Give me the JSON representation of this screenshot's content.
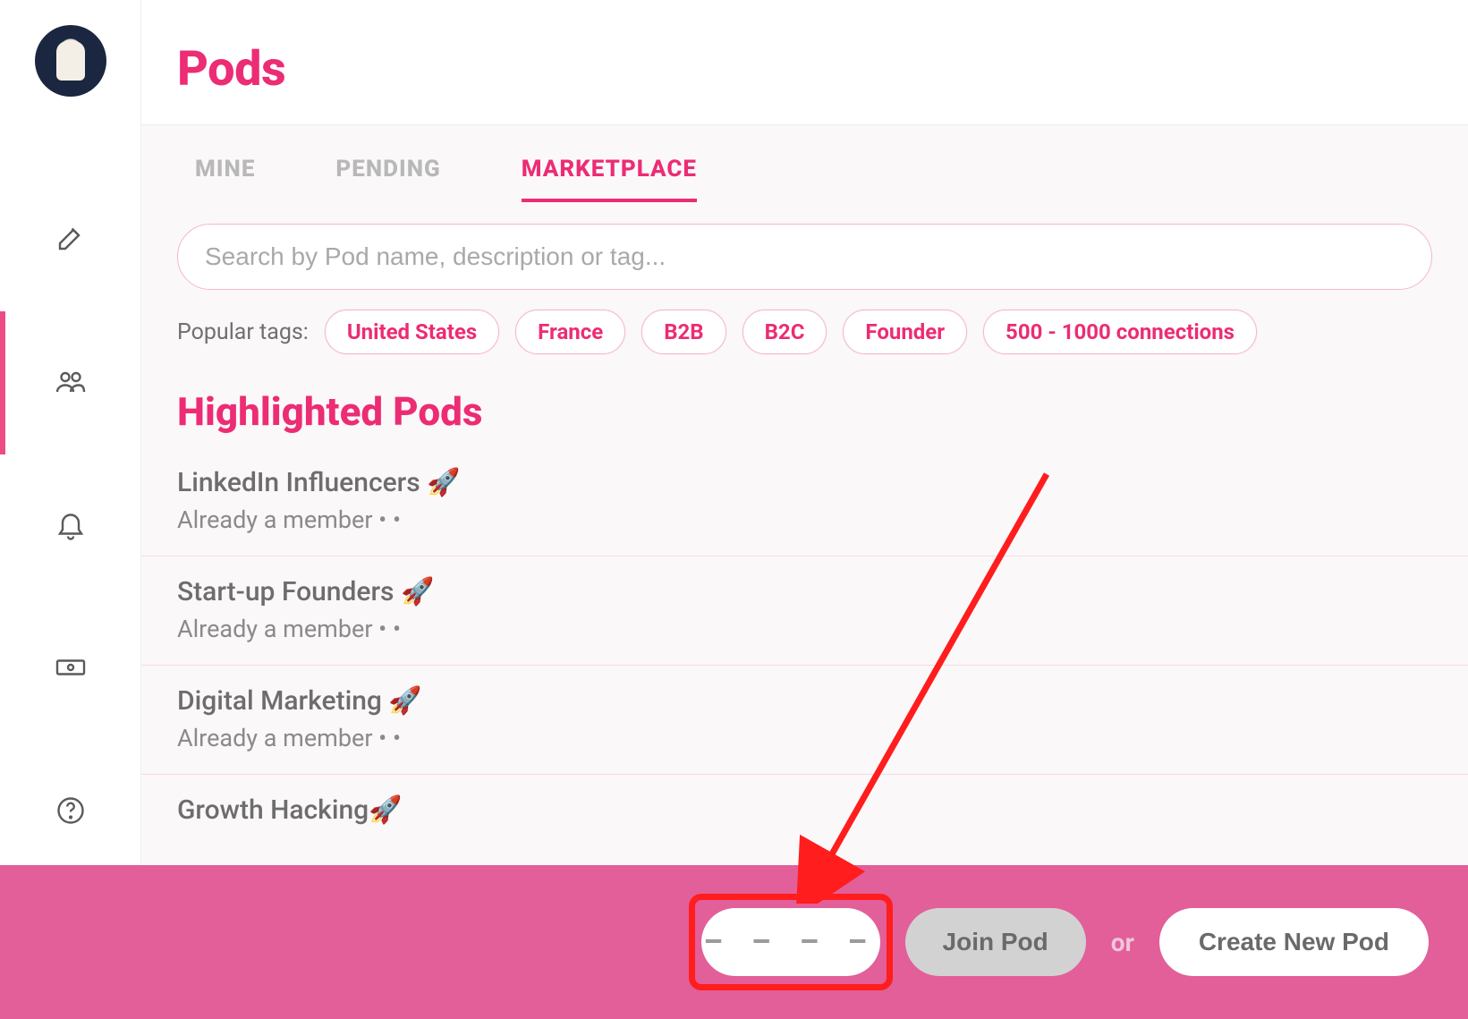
{
  "page": {
    "title": "Pods"
  },
  "tabs": {
    "mine": "MINE",
    "pending": "PENDING",
    "marketplace": "MARKETPLACE",
    "active": "marketplace"
  },
  "search": {
    "placeholder": "Search by Pod name, description or tag..."
  },
  "popular_tags_label": "Popular tags:",
  "tags": [
    "United States",
    "France",
    "B2B",
    "B2C",
    "Founder",
    "500 - 1000 connections"
  ],
  "highlighted_title": "Highlighted Pods",
  "pods": [
    {
      "name": "LinkedIn Influencers 🚀",
      "sub": "Already a member • •"
    },
    {
      "name": "Start-up Founders 🚀",
      "sub": "Already a member • •"
    },
    {
      "name": "Digital Marketing 🚀",
      "sub": "Already a member • •"
    },
    {
      "name": "Growth Hacking🚀",
      "sub": ""
    }
  ],
  "footer": {
    "code_placeholder_visual": "– – – –",
    "join_label": "Join Pod",
    "or": "or",
    "create_label": "Create New Pod"
  }
}
